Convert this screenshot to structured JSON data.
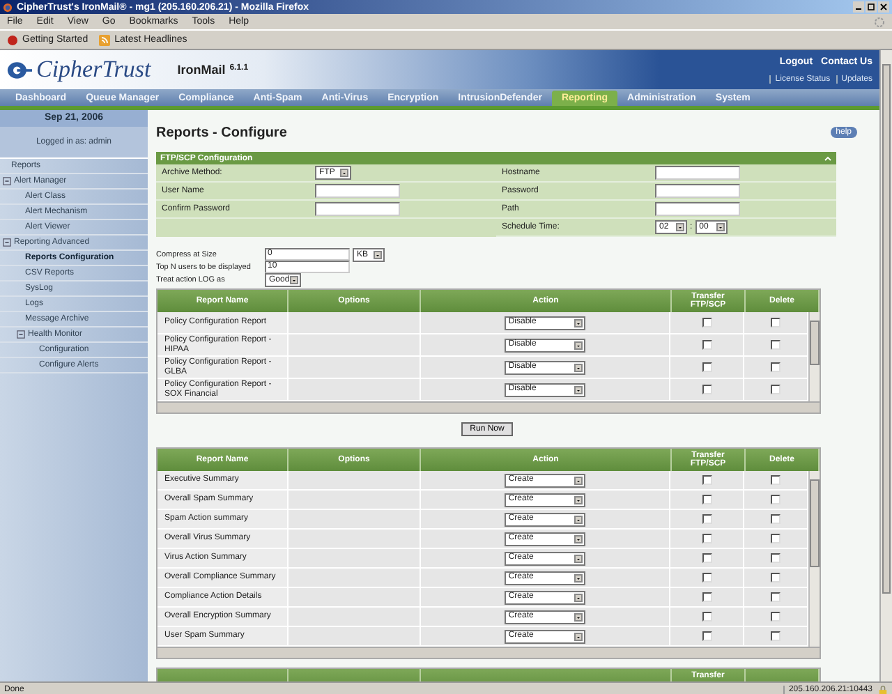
{
  "window": {
    "title": "CipherTrust's IronMail® - mg1 (205.160.206.21) - Mozilla Firefox"
  },
  "menu": [
    "File",
    "Edit",
    "View",
    "Go",
    "Bookmarks",
    "Tools",
    "Help"
  ],
  "bookmarks": [
    {
      "label": "Getting Started",
      "kind": "start"
    },
    {
      "label": "Latest Headlines",
      "kind": "feed"
    }
  ],
  "header": {
    "logo": "CipherTrust",
    "product": "IronMail",
    "version": "6.1.1",
    "links": [
      "Logout",
      "Contact Us"
    ],
    "sublinks": [
      "License Status",
      "Updates"
    ]
  },
  "nav_tabs": [
    {
      "label": "Dashboard",
      "selected": false
    },
    {
      "label": "Queue Manager",
      "selected": false
    },
    {
      "label": "Compliance",
      "selected": false
    },
    {
      "label": "Anti-Spam",
      "selected": false
    },
    {
      "label": "Anti-Virus",
      "selected": false
    },
    {
      "label": "Encryption",
      "selected": false
    },
    {
      "label": "IntrusionDefender",
      "selected": false
    },
    {
      "label": "Reporting",
      "selected": true
    },
    {
      "label": "Administration",
      "selected": false
    },
    {
      "label": "System",
      "selected": false
    }
  ],
  "sidebar": {
    "date": "Sep 21, 2006",
    "login": "Logged in as: admin",
    "tree": [
      {
        "label": "Reports",
        "selected": false
      },
      {
        "label": "Alert Manager",
        "selected": false,
        "expanded": true,
        "children": [
          {
            "label": "Alert Class",
            "selected": false
          },
          {
            "label": "Alert Mechanism",
            "selected": false
          },
          {
            "label": "Alert Viewer",
            "selected": false
          }
        ]
      },
      {
        "label": "Reporting Advanced",
        "selected": false,
        "expanded": true,
        "children": [
          {
            "label": "Reports Configuration",
            "selected": true
          },
          {
            "label": "CSV Reports",
            "selected": false
          },
          {
            "label": "SysLog",
            "selected": false
          },
          {
            "label": "Logs",
            "selected": false
          },
          {
            "label": "Message Archive",
            "selected": false
          },
          {
            "label": "Health Monitor",
            "selected": false,
            "expanded": true,
            "children": [
              {
                "label": "Configuration",
                "selected": false
              },
              {
                "label": "Configure Alerts",
                "selected": false
              }
            ]
          }
        ]
      }
    ]
  },
  "page": {
    "title": "Reports - Configure",
    "help": "help"
  },
  "ftp": {
    "title": "FTP/SCP Configuration",
    "left": [
      {
        "label": "Archive Method:",
        "kind": "select",
        "value": "FTP"
      },
      {
        "label": "User Name",
        "kind": "text"
      },
      {
        "label": "Confirm Password",
        "kind": "text"
      }
    ],
    "right": [
      {
        "label": "Hostname",
        "kind": "text"
      },
      {
        "label": "Password",
        "kind": "text"
      },
      {
        "label": "Path",
        "kind": "text"
      },
      {
        "label": "Schedule Time:",
        "kind": "time",
        "hour": "02",
        "separator": ":",
        "minute": "00"
      }
    ]
  },
  "options": [
    {
      "label": "Compress at Size",
      "kind": "text_unit",
      "value": "0",
      "unit": "KB"
    },
    {
      "label": "Top N users to be displayed",
      "kind": "text",
      "value": "10"
    },
    {
      "label": "Treat action LOG as",
      "kind": "select",
      "value": "Good"
    }
  ],
  "tables": [
    {
      "columns": [
        "Report Name",
        "Options",
        "Action",
        "Transfer FTP/SCP",
        "Delete"
      ],
      "rows": [
        {
          "name": "Policy Configuration Report",
          "action": "Disable",
          "transfer": false,
          "delete": false
        },
        {
          "name": "Policy Configuration Report - HIPAA",
          "action": "Disable",
          "transfer": false,
          "delete": false
        },
        {
          "name": "Policy Configuration Report - GLBA",
          "action": "Disable",
          "transfer": false,
          "delete": false
        },
        {
          "name": "Policy Configuration Report - SOX Financial",
          "action": "Disable",
          "transfer": false,
          "delete": false
        }
      ]
    },
    {
      "columns": [
        "Report Name",
        "Options",
        "Action",
        "Transfer FTP/SCP",
        "Delete"
      ],
      "rows": [
        {
          "name": "Executive Summary",
          "action": "Create",
          "transfer": false,
          "delete": false
        },
        {
          "name": "Overall Spam Summary",
          "action": "Create",
          "transfer": false,
          "delete": false
        },
        {
          "name": "Spam Action summary",
          "action": "Create",
          "transfer": false,
          "delete": false
        },
        {
          "name": "Overall Virus Summary",
          "action": "Create",
          "transfer": false,
          "delete": false
        },
        {
          "name": "Virus Action Summary",
          "action": "Create",
          "transfer": false,
          "delete": false
        },
        {
          "name": "Overall Compliance Summary",
          "action": "Create",
          "transfer": false,
          "delete": false
        },
        {
          "name": "Compliance Action Details",
          "action": "Create",
          "transfer": false,
          "delete": false
        },
        {
          "name": "Overall Encryption Summary",
          "action": "Create",
          "transfer": false,
          "delete": false
        },
        {
          "name": "User Spam Summary",
          "action": "Create",
          "transfer": false,
          "delete": false
        }
      ]
    }
  ],
  "run_button": "Run Now",
  "partial_table": {
    "column_4": "Transfer"
  },
  "status_bar": {
    "text": "Done",
    "address": "205.160.206.21:10443"
  }
}
